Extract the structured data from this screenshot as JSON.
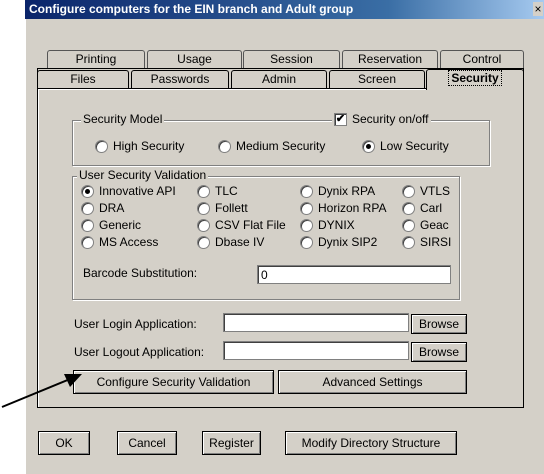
{
  "window": {
    "title": "Configure computers for the EIN branch and Adult group",
    "close_glyph": "×"
  },
  "tabs_back": [
    "Printing",
    "Usage",
    "Session",
    "Reservation",
    "Control"
  ],
  "tabs_front": [
    "Files",
    "Passwords",
    "Admin",
    "Screen",
    "Security"
  ],
  "security_model": {
    "legend": "Security Model",
    "toggle_label": "Security on/off",
    "toggle_checked": true,
    "options": [
      "High Security",
      "Medium Security",
      "Low Security"
    ],
    "selected": "Low Security"
  },
  "validation": {
    "legend": "User Security Validation",
    "options": [
      "Innovative API",
      "TLC",
      "Dynix RPA",
      "VTLS",
      "DRA",
      "Follett",
      "Horizon RPA",
      "Carl",
      "Generic",
      "CSV Flat File",
      "DYNIX",
      "Geac",
      "MS Access",
      "Dbase IV",
      "Dynix SIP2",
      "SIRSI"
    ],
    "selected": "Innovative API",
    "barcode_label": "Barcode Substitution:",
    "barcode_value": "0"
  },
  "login": {
    "label": "User Login Application:",
    "value": "",
    "browse": "Browse"
  },
  "logout": {
    "label": "User Logout Application:",
    "value": "",
    "browse": "Browse"
  },
  "buttons": {
    "configure": "Configure Security Validation",
    "advanced": "Advanced Settings",
    "ok": "OK",
    "cancel": "Cancel",
    "register": "Register",
    "modify": "Modify Directory Structure"
  }
}
